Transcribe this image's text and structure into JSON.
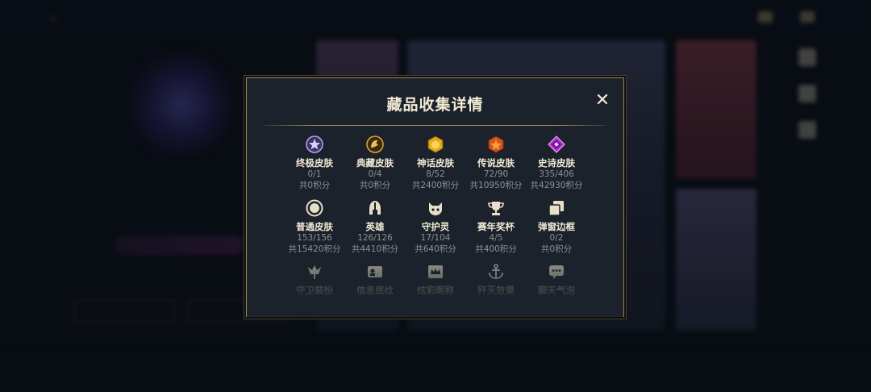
{
  "modal": {
    "title": "藏品收集详情",
    "close_label": "✕",
    "row1": [
      {
        "name": "终极皮肤",
        "count": "0/1",
        "points": "共0积分"
      },
      {
        "name": "典藏皮肤",
        "count": "0/4",
        "points": "共0积分"
      },
      {
        "name": "神话皮肤",
        "count": "8/52",
        "points": "共2400积分"
      },
      {
        "name": "传说皮肤",
        "count": "72/90",
        "points": "共10950积分"
      },
      {
        "name": "史诗皮肤",
        "count": "335/406",
        "points": "共42930积分"
      }
    ],
    "row2": [
      {
        "name": "普通皮肤",
        "count": "153/156",
        "points": "共15420积分"
      },
      {
        "name": "英雄",
        "count": "126/126",
        "points": "共4410积分"
      },
      {
        "name": "守护灵",
        "count": "17/104",
        "points": "共640积分"
      },
      {
        "name": "赛年奖杯",
        "count": "4/5",
        "points": "共400积分"
      },
      {
        "name": "弹窗边框",
        "count": "0/2",
        "points": "共0积分"
      }
    ],
    "row3": [
      {
        "name": "守卫装扮"
      },
      {
        "name": "信息底纹"
      },
      {
        "name": "炫彩昵称"
      },
      {
        "name": "歼灭效果"
      },
      {
        "name": "聊天气泡"
      }
    ]
  },
  "colors": {
    "accent_gold": "#a48b50",
    "modal_bg": "#1b222b",
    "title_text": "#f1e9d3",
    "secondary_text": "#8f9196"
  }
}
